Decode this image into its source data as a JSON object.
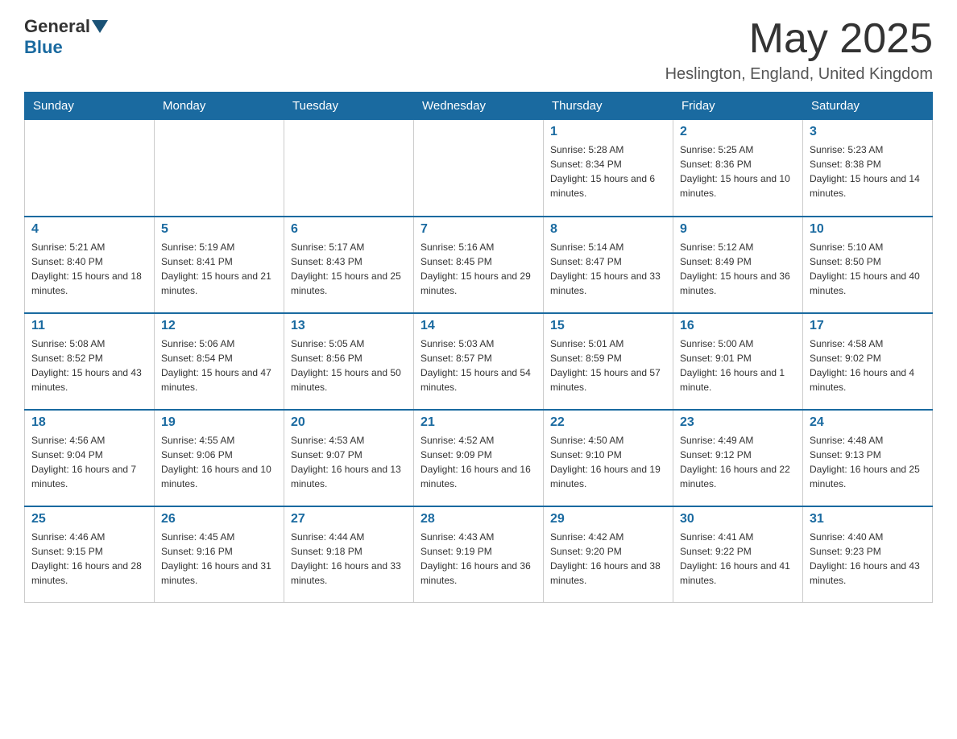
{
  "header": {
    "logo_general": "General",
    "logo_blue": "Blue",
    "month_title": "May 2025",
    "location": "Heslington, England, United Kingdom"
  },
  "days_of_week": [
    "Sunday",
    "Monday",
    "Tuesday",
    "Wednesday",
    "Thursday",
    "Friday",
    "Saturday"
  ],
  "weeks": [
    [
      {
        "day": "",
        "info": ""
      },
      {
        "day": "",
        "info": ""
      },
      {
        "day": "",
        "info": ""
      },
      {
        "day": "",
        "info": ""
      },
      {
        "day": "1",
        "info": "Sunrise: 5:28 AM\nSunset: 8:34 PM\nDaylight: 15 hours and 6 minutes."
      },
      {
        "day": "2",
        "info": "Sunrise: 5:25 AM\nSunset: 8:36 PM\nDaylight: 15 hours and 10 minutes."
      },
      {
        "day": "3",
        "info": "Sunrise: 5:23 AM\nSunset: 8:38 PM\nDaylight: 15 hours and 14 minutes."
      }
    ],
    [
      {
        "day": "4",
        "info": "Sunrise: 5:21 AM\nSunset: 8:40 PM\nDaylight: 15 hours and 18 minutes."
      },
      {
        "day": "5",
        "info": "Sunrise: 5:19 AM\nSunset: 8:41 PM\nDaylight: 15 hours and 21 minutes."
      },
      {
        "day": "6",
        "info": "Sunrise: 5:17 AM\nSunset: 8:43 PM\nDaylight: 15 hours and 25 minutes."
      },
      {
        "day": "7",
        "info": "Sunrise: 5:16 AM\nSunset: 8:45 PM\nDaylight: 15 hours and 29 minutes."
      },
      {
        "day": "8",
        "info": "Sunrise: 5:14 AM\nSunset: 8:47 PM\nDaylight: 15 hours and 33 minutes."
      },
      {
        "day": "9",
        "info": "Sunrise: 5:12 AM\nSunset: 8:49 PM\nDaylight: 15 hours and 36 minutes."
      },
      {
        "day": "10",
        "info": "Sunrise: 5:10 AM\nSunset: 8:50 PM\nDaylight: 15 hours and 40 minutes."
      }
    ],
    [
      {
        "day": "11",
        "info": "Sunrise: 5:08 AM\nSunset: 8:52 PM\nDaylight: 15 hours and 43 minutes."
      },
      {
        "day": "12",
        "info": "Sunrise: 5:06 AM\nSunset: 8:54 PM\nDaylight: 15 hours and 47 minutes."
      },
      {
        "day": "13",
        "info": "Sunrise: 5:05 AM\nSunset: 8:56 PM\nDaylight: 15 hours and 50 minutes."
      },
      {
        "day": "14",
        "info": "Sunrise: 5:03 AM\nSunset: 8:57 PM\nDaylight: 15 hours and 54 minutes."
      },
      {
        "day": "15",
        "info": "Sunrise: 5:01 AM\nSunset: 8:59 PM\nDaylight: 15 hours and 57 minutes."
      },
      {
        "day": "16",
        "info": "Sunrise: 5:00 AM\nSunset: 9:01 PM\nDaylight: 16 hours and 1 minute."
      },
      {
        "day": "17",
        "info": "Sunrise: 4:58 AM\nSunset: 9:02 PM\nDaylight: 16 hours and 4 minutes."
      }
    ],
    [
      {
        "day": "18",
        "info": "Sunrise: 4:56 AM\nSunset: 9:04 PM\nDaylight: 16 hours and 7 minutes."
      },
      {
        "day": "19",
        "info": "Sunrise: 4:55 AM\nSunset: 9:06 PM\nDaylight: 16 hours and 10 minutes."
      },
      {
        "day": "20",
        "info": "Sunrise: 4:53 AM\nSunset: 9:07 PM\nDaylight: 16 hours and 13 minutes."
      },
      {
        "day": "21",
        "info": "Sunrise: 4:52 AM\nSunset: 9:09 PM\nDaylight: 16 hours and 16 minutes."
      },
      {
        "day": "22",
        "info": "Sunrise: 4:50 AM\nSunset: 9:10 PM\nDaylight: 16 hours and 19 minutes."
      },
      {
        "day": "23",
        "info": "Sunrise: 4:49 AM\nSunset: 9:12 PM\nDaylight: 16 hours and 22 minutes."
      },
      {
        "day": "24",
        "info": "Sunrise: 4:48 AM\nSunset: 9:13 PM\nDaylight: 16 hours and 25 minutes."
      }
    ],
    [
      {
        "day": "25",
        "info": "Sunrise: 4:46 AM\nSunset: 9:15 PM\nDaylight: 16 hours and 28 minutes."
      },
      {
        "day": "26",
        "info": "Sunrise: 4:45 AM\nSunset: 9:16 PM\nDaylight: 16 hours and 31 minutes."
      },
      {
        "day": "27",
        "info": "Sunrise: 4:44 AM\nSunset: 9:18 PM\nDaylight: 16 hours and 33 minutes."
      },
      {
        "day": "28",
        "info": "Sunrise: 4:43 AM\nSunset: 9:19 PM\nDaylight: 16 hours and 36 minutes."
      },
      {
        "day": "29",
        "info": "Sunrise: 4:42 AM\nSunset: 9:20 PM\nDaylight: 16 hours and 38 minutes."
      },
      {
        "day": "30",
        "info": "Sunrise: 4:41 AM\nSunset: 9:22 PM\nDaylight: 16 hours and 41 minutes."
      },
      {
        "day": "31",
        "info": "Sunrise: 4:40 AM\nSunset: 9:23 PM\nDaylight: 16 hours and 43 minutes."
      }
    ]
  ]
}
